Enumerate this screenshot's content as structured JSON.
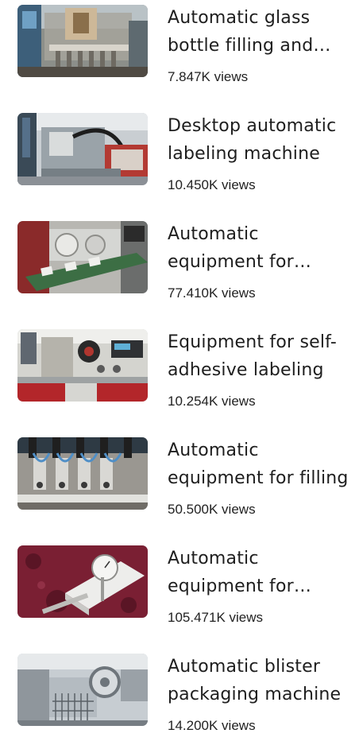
{
  "videos": [
    {
      "title": "Automatic glass bottle filling and capping machine",
      "views": "7.847K views",
      "thumbnail": "glass-bottle-filling-machine"
    },
    {
      "title": "Desktop automatic labeling machine",
      "views": "10.450K views",
      "thumbnail": "desktop-labeling-machine"
    },
    {
      "title": "Automatic equipment for labeling",
      "views": "77.410K views",
      "thumbnail": "conveyor-labeling-equipment"
    },
    {
      "title": "Equipment for self-adhesive labeling",
      "views": "10.254K views",
      "thumbnail": "self-adhesive-labeler"
    },
    {
      "title": "Automatic equipment for filling",
      "views": "50.500K views",
      "thumbnail": "multi-head-filling-equipment"
    },
    {
      "title": "Automatic equipment for testing",
      "views": "105.471K views",
      "thumbnail": "dial-gauge-tester"
    },
    {
      "title": "Automatic blister packaging machine",
      "views": "14.200K views",
      "thumbnail": "blister-packaging-machine"
    }
  ]
}
